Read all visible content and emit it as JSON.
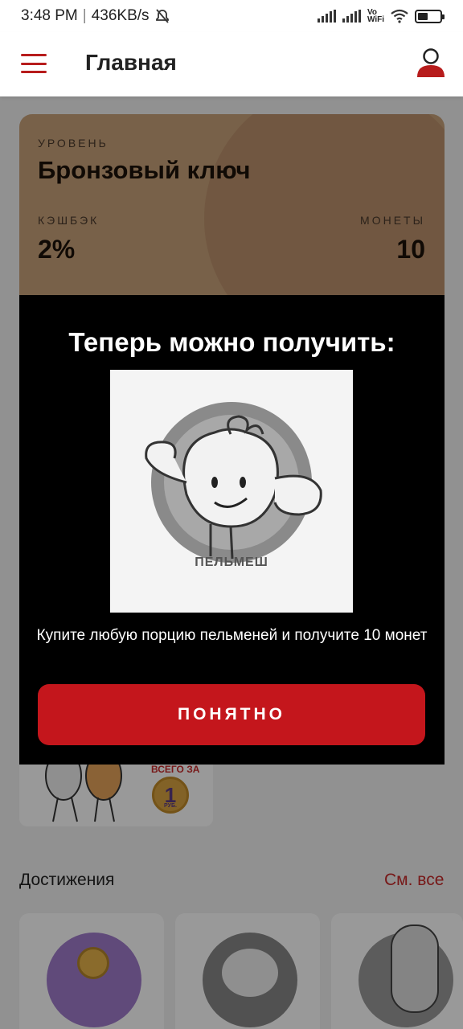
{
  "status_bar": {
    "time": "3:48 PM",
    "separator": "|",
    "speed": "436KB/s",
    "vo": "Vo",
    "wifi_label": "WiFi",
    "battery_percent": 45
  },
  "header": {
    "title": "Главная"
  },
  "level_card": {
    "level_label": "УРОВЕНЬ",
    "level_name": "Бронзовый ключ",
    "cashback_label": "КЭШБЭК",
    "cashback_value": "2%",
    "coins_label": "МОНЕТЫ",
    "coins_value": "10"
  },
  "promo": {
    "price_prefix": "ВСЕГО ЗА",
    "coin_value": "1",
    "currency": "РУБ."
  },
  "achievements": {
    "title": "Достижения",
    "see_all": "См. все"
  },
  "dialog": {
    "title": "Теперь можно получить:",
    "image_caption": "ПЕЛЬМЕШ",
    "description": "Купите любую порцию пельменей и получите 10 монет",
    "button_label": "ПОНЯТНО"
  },
  "colors": {
    "accent": "#c4161c",
    "card_bronze": "#c9a27a",
    "dialog_bg": "#000000"
  }
}
